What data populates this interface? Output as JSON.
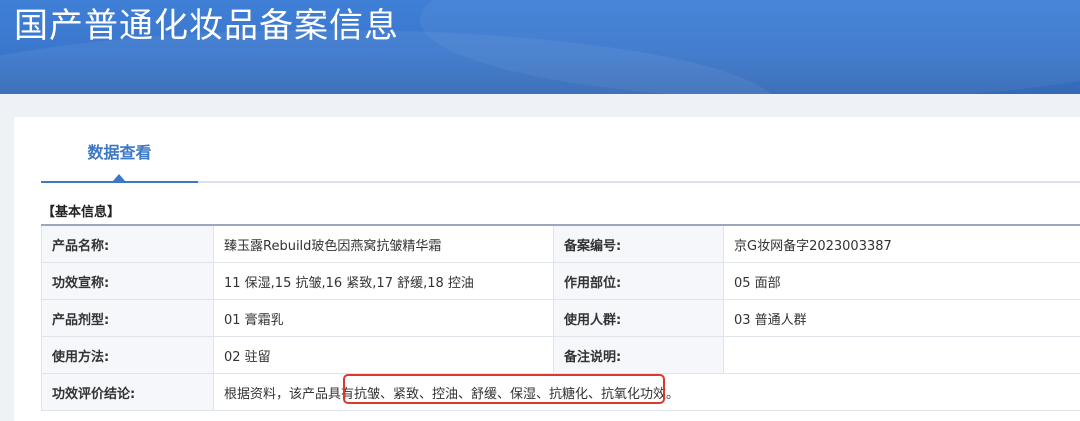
{
  "page": {
    "title": "国产普通化妆品备案信息"
  },
  "tabs": [
    {
      "label": "数据查看"
    }
  ],
  "section": {
    "title": "【基本信息】"
  },
  "info": {
    "product_name": {
      "label": "产品名称:",
      "value": "臻玉露Rebuild玻色因燕窝抗皱精华霜"
    },
    "record_no": {
      "label": "备案编号:",
      "value": "京G妆网备字2023003387"
    },
    "efficacy_claim": {
      "label": "功效宣称:",
      "value": "11 保湿,15 抗皱,16 紧致,17 舒缓,18 控油"
    },
    "application_area": {
      "label": "作用部位:",
      "value": "05 面部"
    },
    "dosage_form": {
      "label": "产品剂型:",
      "value": "01 膏霜乳"
    },
    "target_group": {
      "label": "使用人群:",
      "value": "03 普通人群"
    },
    "usage_method": {
      "label": "使用方法:",
      "value": "02 驻留"
    },
    "remarks": {
      "label": "备注说明:",
      "value": ""
    },
    "efficacy_conclusion": {
      "label": "功效评价结论:",
      "value": "根据资料，该产品具有抗皱、紧致、控油、舒缓、保湿、抗糖化、抗氧化功效。"
    }
  },
  "colors": {
    "banner": "#3a77cc",
    "tab_accent": "#3c78c6",
    "highlight": "#d93a2e"
  }
}
